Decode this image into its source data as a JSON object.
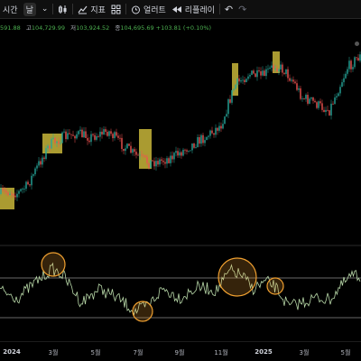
{
  "toolbar": {
    "time_label": "시간",
    "interval_label": "날",
    "indicators_label": "지표",
    "alerts_label": "얼러트",
    "replay_label": "리플레이"
  },
  "ohlc": {
    "open": "591.88",
    "high_label": "고",
    "high": "104,729.99",
    "low_label": "저",
    "low": "103,924.52",
    "close_label": "종",
    "close": "104,695.69",
    "change": "+103.81 (+0.10%)"
  },
  "time_axis": [
    "2024",
    "3월",
    "5월",
    "7월",
    "9월",
    "11월",
    "2025",
    "3월",
    "5월"
  ],
  "colors": {
    "up": "#26a69a",
    "down": "#ef5350",
    "highlight_box": "#c8b63a",
    "circle": "#f0a030",
    "oscillator": "#b8d8a8",
    "background": "#000000"
  }
}
